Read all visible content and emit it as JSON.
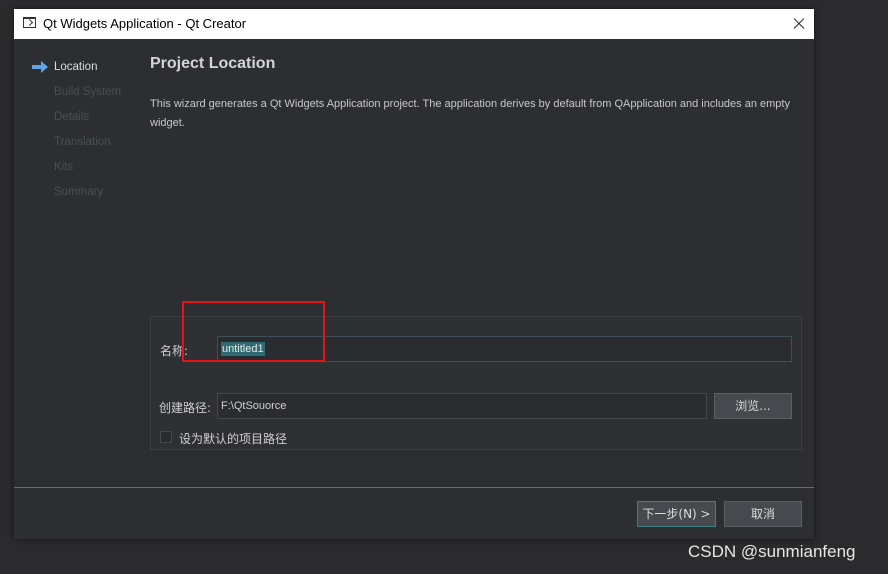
{
  "window": {
    "title": "Qt Widgets Application - Qt Creator"
  },
  "steps": [
    {
      "label": "Location",
      "active": true
    },
    {
      "label": "Build System",
      "active": false
    },
    {
      "label": "Details",
      "active": false
    },
    {
      "label": "Translation",
      "active": false
    },
    {
      "label": "Kits",
      "active": false
    },
    {
      "label": "Summary",
      "active": false
    }
  ],
  "page": {
    "heading": "Project Location",
    "description": "This wizard generates a Qt Widgets Application project. The application derives by default from QApplication and includes an empty widget."
  },
  "form": {
    "name_label": "名称:",
    "name_value": "untitled1",
    "path_label": "创建路径:",
    "path_value": "F:\\QtSouorce",
    "browse_label": "浏览...",
    "default_path_label": "设为默认的项目路径",
    "default_path_checked": false
  },
  "buttons": {
    "next_label": "下一步(N) >",
    "cancel_label": "取消"
  },
  "watermark": "CSDN @sunmianfeng",
  "colors": {
    "accent": "#3f7f86",
    "highlight": "#e3151a",
    "arrow": "#5ea4e8"
  },
  "icons": {
    "app": "qt-creator-window-icon",
    "current_step": "arrow-right-icon",
    "close": "close-icon"
  }
}
